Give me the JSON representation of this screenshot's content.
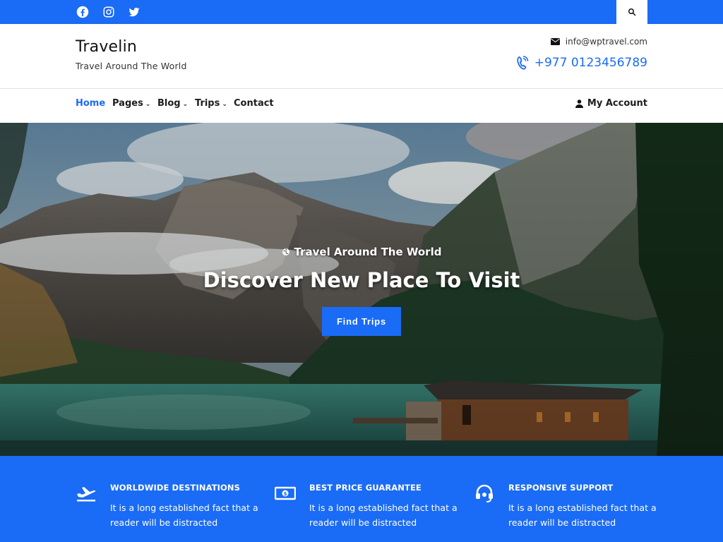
{
  "topbar": {
    "social": [
      "facebook-icon",
      "instagram-icon",
      "twitter-icon"
    ],
    "search_icon": "search-icon",
    "color": "#1a6bf5"
  },
  "header": {
    "site_title": "Travelin",
    "tagline": "Travel Around The World",
    "email": "info@wptravel.com",
    "phone": "+977 0123456789"
  },
  "nav": {
    "items": [
      {
        "label": "Home",
        "active": true
      },
      {
        "label": "Pages",
        "dropdown": true
      },
      {
        "label": "Blog",
        "dropdown": true
      },
      {
        "label": "Trips",
        "dropdown": true
      },
      {
        "label": "Contact"
      }
    ],
    "account_label": "My Account",
    "caret": "⌄"
  },
  "hero": {
    "subtitle": "Travel Around The World",
    "title": "Discover New Place To Visit",
    "button_label": "Find Trips"
  },
  "features": [
    {
      "icon": "plane-icon",
      "title": "WORLDWIDE DESTINATIONS",
      "text": "It is a long established fact that a reader will be distracted"
    },
    {
      "icon": "money-icon",
      "title": "BEST PRICE GUARANTEE",
      "text": "It is a long established fact that a reader will be distracted"
    },
    {
      "icon": "headset-icon",
      "title": "RESPONSIVE SUPPORT",
      "text": "It is a long established fact that a reader will be distracted"
    }
  ],
  "colors": {
    "accent": "#1a6bf5"
  }
}
